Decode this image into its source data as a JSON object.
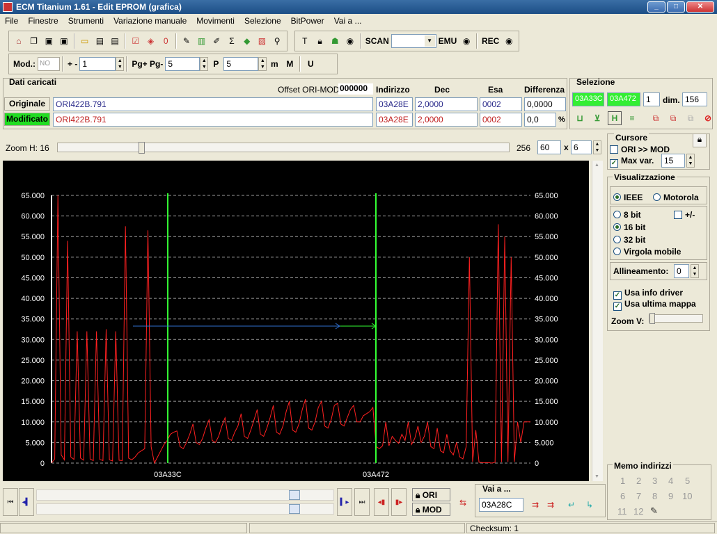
{
  "window": {
    "title": "ECM Titanium 1.61 - Edit EPROM (grafica)"
  },
  "menu": [
    "File",
    "Finestre",
    "Strumenti",
    "Variazione manuale",
    "Movimenti",
    "Selezione",
    "BitPower",
    "Vai a ..."
  ],
  "toolbar": {
    "scan": "SCAN",
    "emu": "EMU",
    "rec": "REC",
    "scan_value": ""
  },
  "mod_bar": {
    "mod_label": "Mod.:",
    "mod_value": "NO",
    "plusminus": "+ -",
    "step": "1",
    "pg": "Pg+ Pg-",
    "pg_value": "5",
    "p_value": "5"
  },
  "loaded": {
    "title": "Dati caricati",
    "offset_label": "Offset ORI-MOD",
    "offset": "000000",
    "headers": {
      "indirizzo": "Indirizzo",
      "dec": "Dec",
      "esa": "Esa",
      "diff": "Differenza"
    },
    "orig": {
      "label": "Originale",
      "file": "ORI422B.791",
      "addr": "03A28E",
      "dec": "2,0000",
      "hex": "0002",
      "diff": "0,0000"
    },
    "mod": {
      "label": "Modificato",
      "file": "ORI422B.791",
      "addr": "03A28E",
      "dec": "2,0000",
      "hex": "0002",
      "diff": "0,0",
      "pct": "%"
    }
  },
  "selection": {
    "title": "Selezione",
    "start": "03A33C",
    "end": "03A472",
    "count": "1",
    "dim_label": "dim.",
    "dim": "156"
  },
  "zoom": {
    "label": "Zoom H: 16",
    "value": "256",
    "w": "60",
    "x": "x",
    "h": "6"
  },
  "cursor": {
    "title": "Cursore",
    "ori_mod": "ORI >> MOD",
    "maxvar": "Max var.",
    "maxvar_value": "15"
  },
  "visual": {
    "title": "Visualizzazione",
    "ieee": "IEEE",
    "motorola": "Motorola",
    "bit8": "8 bit",
    "pm": "+/-",
    "bit16": "16 bit",
    "bit32": "32 bit",
    "float": "Virgola mobile",
    "align_label": "Allineamento:",
    "align": "0",
    "driver": "Usa info driver",
    "lastmap": "Usa ultima mappa",
    "zoomv": "Zoom V:"
  },
  "chart_data": {
    "type": "line",
    "y_ticks": [
      "0",
      "5.000",
      "10.000",
      "15.000",
      "20.000",
      "25.000",
      "30.000",
      "35.000",
      "40.000",
      "45.000",
      "50.000",
      "55.000",
      "60.000",
      "65.000"
    ],
    "ylim": [
      0,
      65000
    ],
    "grid": true,
    "markers": [
      {
        "label": "03A33C",
        "color": "#33ff33"
      },
      {
        "label": "03A472",
        "color": "#33ff33"
      }
    ],
    "series_color": "#ff2020",
    "series": [
      {
        "values": [
          0,
          1000,
          65000,
          2000,
          800,
          54000,
          1500,
          900,
          32000,
          1200,
          700,
          32000,
          1000,
          600,
          32000,
          900,
          600,
          32500,
          800,
          500,
          32000,
          700,
          600,
          57500,
          1200,
          800,
          1500,
          2500,
          3000,
          3500,
          56500,
          4000,
          0,
          1500,
          3000,
          4500,
          5500,
          7000,
          7500,
          7800,
          4000,
          3500,
          5000,
          7000,
          9500,
          5000,
          4500,
          6000,
          8500,
          10500,
          5500,
          5000,
          6500,
          9000,
          11000,
          6000,
          5500,
          7500,
          9000,
          12000,
          6500,
          6000,
          8000,
          10500,
          13000,
          7000,
          6500,
          8500,
          11000,
          14000,
          7500,
          7000,
          9000,
          12500,
          15000,
          8000,
          7500,
          9500,
          13000,
          15500,
          8500,
          8000,
          10000,
          13500,
          15000,
          9000,
          8500,
          10500,
          14000,
          14500,
          9500,
          9000,
          11000,
          13000,
          14000,
          10000,
          10000,
          11500,
          12000,
          12500,
          13500,
          4000,
          3500,
          4200,
          10000,
          4200,
          6500,
          5500,
          4800,
          7000,
          5500,
          10000,
          4500,
          6000,
          9000,
          5000,
          6500,
          10000,
          4000,
          3500,
          8500,
          3000,
          2500,
          7000,
          3000,
          2000,
          5000,
          1500,
          1000,
          4000,
          50000,
          300,
          8000,
          200,
          100,
          100,
          100,
          0,
          200,
          58000,
          200,
          55000,
          300,
          50000,
          300,
          10000,
          5000,
          10000,
          10000,
          10000
        ]
      }
    ],
    "arrow_color": "#3070d0"
  },
  "nav": {
    "ori": "ORI",
    "mod": "MOD",
    "goto_title": "Vai a ...",
    "goto_value": "03A28C"
  },
  "memo": {
    "title": "Memo indirizzi",
    "slots": [
      "1",
      "2",
      "3",
      "4",
      "5",
      "6",
      "7",
      "8",
      "9",
      "10",
      "11",
      "12"
    ]
  },
  "status": {
    "checksum": "Checksum: 1"
  }
}
